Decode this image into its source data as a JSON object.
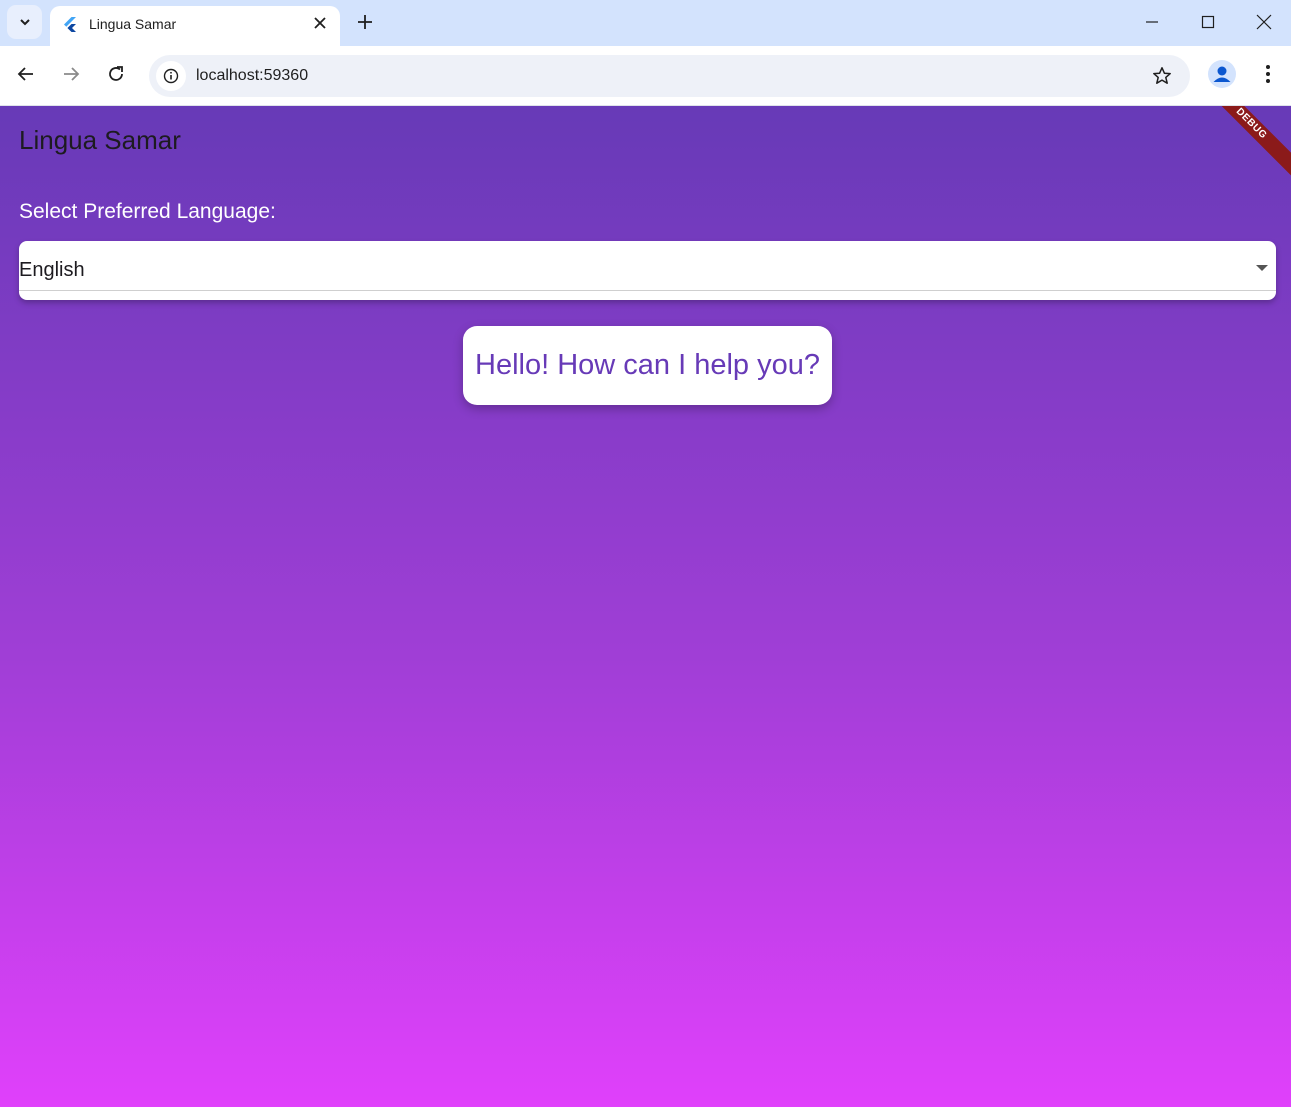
{
  "browser": {
    "tab_title": "Lingua Samar",
    "url": "localhost:59360"
  },
  "app": {
    "title": "Lingua Samar",
    "debug_label": "DEBUG",
    "language_label": "Select Preferred Language:",
    "selected_language": "English",
    "greeting": "Hello! How can I help you?"
  },
  "colors": {
    "accent": "#673ab7",
    "gradient_top": "#673ab7",
    "gradient_bottom": "#e040fb",
    "debug_ribbon": "#8b1a1a"
  }
}
